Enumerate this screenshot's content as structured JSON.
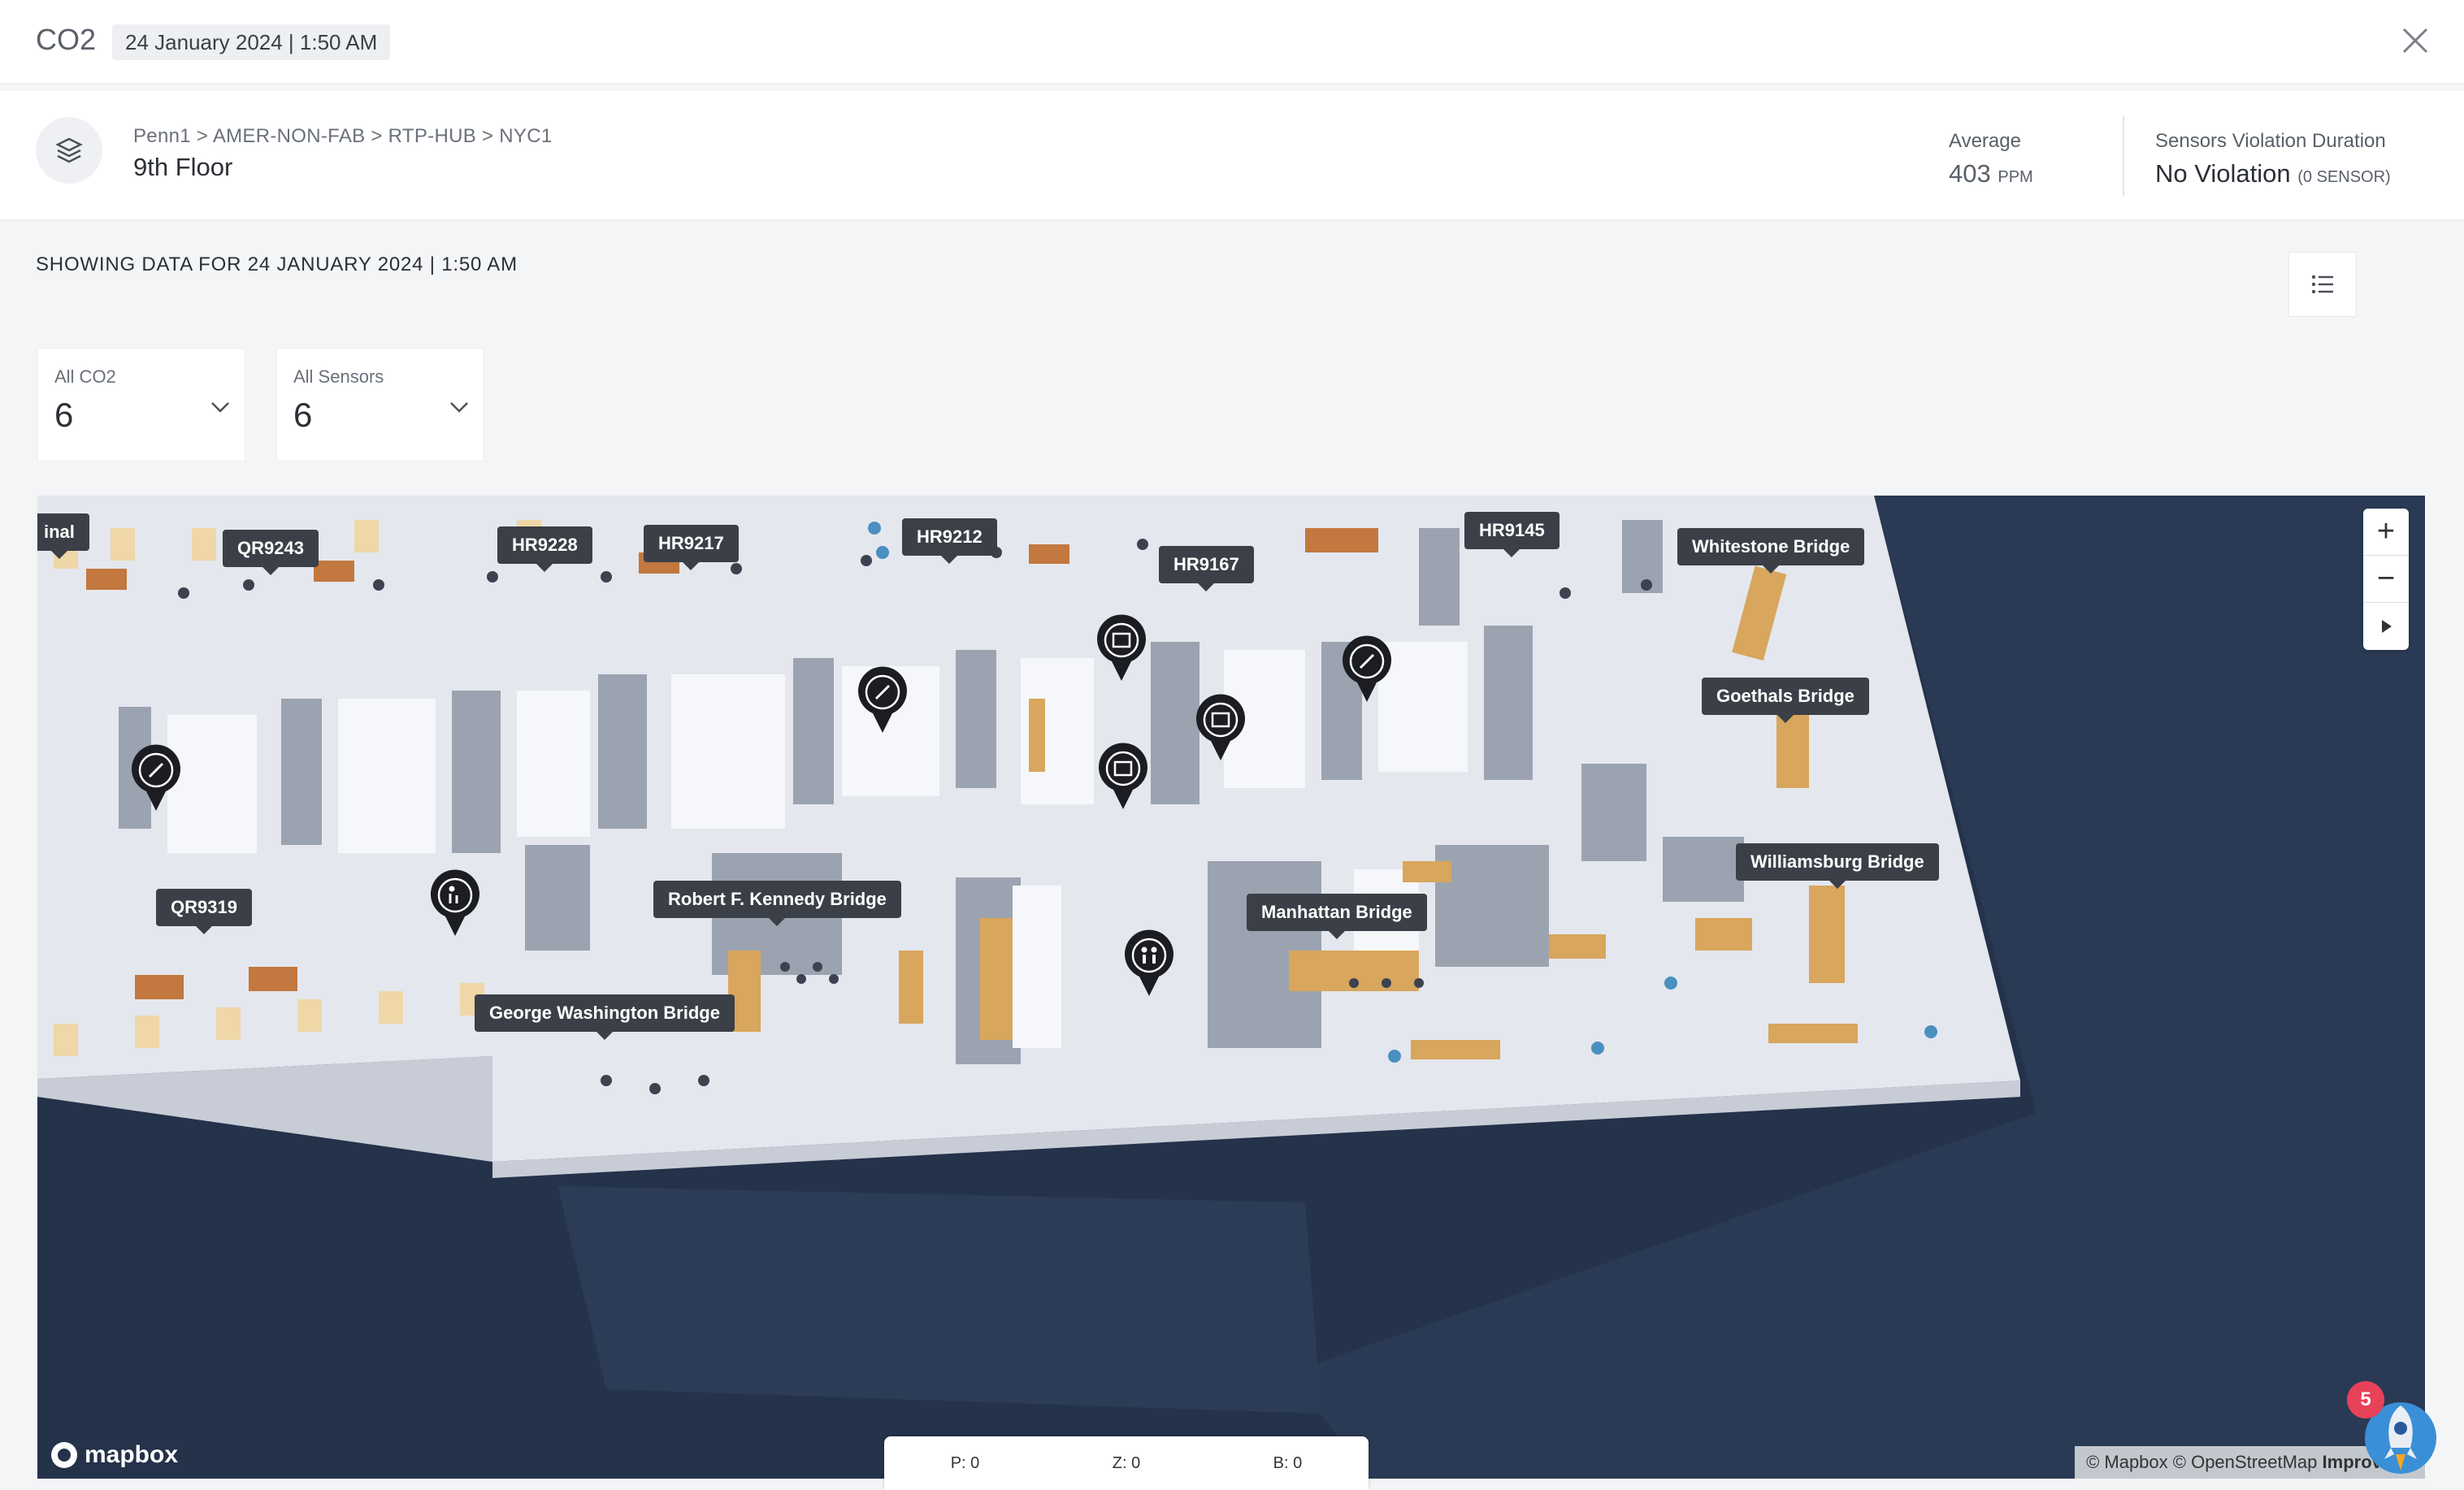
{
  "header": {
    "title": "CO2",
    "date_chip": "24 January 2024 | 1:50 AM"
  },
  "location": {
    "breadcrumb": "Penn1 > AMER-NON-FAB > RTP-HUB > NYC1",
    "floor": "9th Floor"
  },
  "metrics": {
    "average_label": "Average",
    "average_value": "403",
    "average_unit": "PPM",
    "violation_label": "Sensors Violation Duration",
    "violation_value": "No Violation",
    "violation_detail": "(0 SENSOR)"
  },
  "showing_text": "SHOWING DATA FOR 24 JANUARY 2024 | 1:50 AM",
  "filters": [
    {
      "label": "All CO2",
      "value": "6"
    },
    {
      "label": "All Sensors",
      "value": "6"
    }
  ],
  "map": {
    "room_labels": [
      "inal",
      "QR9243",
      "HR9228",
      "HR9217",
      "HR9212",
      "HR9167",
      "HR9145",
      "Whitestone Bridge",
      "Goethals Bridge",
      "Williamsburg Bridge",
      "Manhattan Bridge",
      "Robert F. Kennedy Bridge",
      "George Washington Bridge",
      "QR9319"
    ],
    "attribution": {
      "prefix": "© Mapbox © OpenStreetMap",
      "link": "Improve th"
    },
    "logo": "mapbox",
    "zoom_in": "+",
    "zoom_out": "−"
  },
  "status_bar": {
    "p": "P: 0",
    "z": "Z: 0",
    "b": "B: 0"
  },
  "assistant_badge": "5",
  "colors": {
    "accent": "#2b8ad6",
    "map_bg": "#24324a",
    "floor": "#dfe2ea",
    "furniture": "#d8a65c",
    "label_bg": "#3b3f47",
    "badge": "#e8415a"
  },
  "icons": {
    "close": "close-icon",
    "layers": "layers-icon",
    "list_view": "list-icon",
    "map_view": "map-pin-icon",
    "chevron": "chevron-down-icon",
    "rocket": "rocket-icon"
  }
}
